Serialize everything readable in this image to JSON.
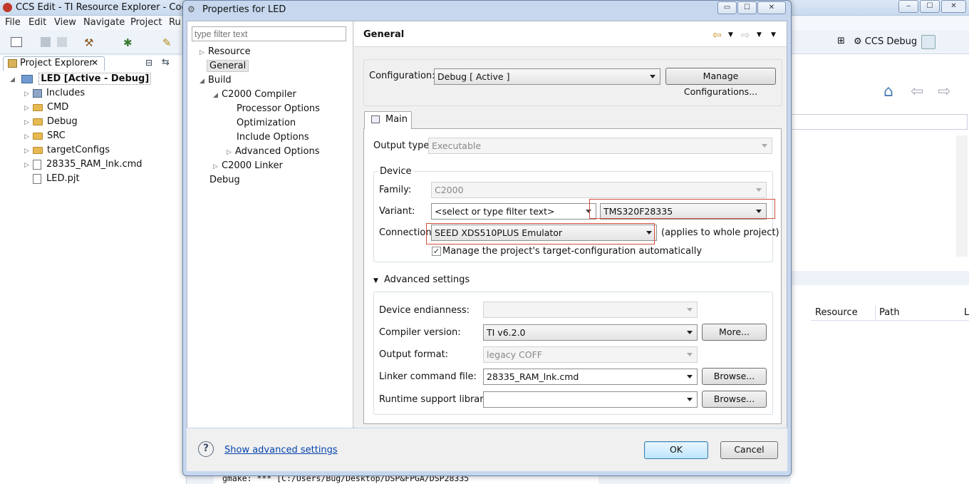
{
  "main_window": {
    "title": "CCS Edit - TI Resource Explorer - Code C",
    "menu": [
      "File",
      "Edit",
      "View",
      "Navigate",
      "Project",
      "Ru"
    ],
    "perspective": "CCS Debug"
  },
  "project_explorer": {
    "tab_label": "Project Explorer",
    "tab_close": "✕",
    "root": "LED  [Active - Debug]",
    "items": [
      "Includes",
      "CMD",
      "Debug",
      "SRC",
      "targetConfigs",
      "28335_RAM_lnk.cmd",
      "LED.pjt"
    ]
  },
  "right_table": {
    "columns": [
      "Resource",
      "Path",
      "L"
    ]
  },
  "console": {
    "line": "gmake: *** [C:/Users/Bug/Desktop/DSP&FPGA/DSP28335"
  },
  "dialog": {
    "title": "Properties for LED",
    "win_buttons": [
      "▭",
      "☐",
      "✕"
    ],
    "filter_placeholder": "type filter text",
    "nav": [
      {
        "label": "Resource",
        "level": 0,
        "arrow": "▷"
      },
      {
        "label": "General",
        "level": 0,
        "selected": true
      },
      {
        "label": "Build",
        "level": 0,
        "arrow": "◢"
      },
      {
        "label": "C2000 Compiler",
        "level": 1,
        "arrow": "◢"
      },
      {
        "label": "Processor Options",
        "level": 2
      },
      {
        "label": "Optimization",
        "level": 2
      },
      {
        "label": "Include Options",
        "level": 2
      },
      {
        "label": "Advanced Options",
        "level": 2,
        "arrow": "▷"
      },
      {
        "label": "C2000 Linker",
        "level": 1,
        "arrow": "▷"
      },
      {
        "label": "Debug",
        "level": 0
      }
    ],
    "page_title": "General",
    "configuration_label": "Configuration:",
    "configuration_value": "Debug  [ Active ]",
    "manage_button": "Manage Configurations...",
    "tab_main": "Main",
    "output_type_label": "Output type:",
    "output_type_value": "Executable",
    "device_group": "Device",
    "family_label": "Family:",
    "family_value": "C2000",
    "variant_label": "Variant:",
    "variant_filter": "<select or type filter text>",
    "variant_value": "TMS320F28335",
    "connection_label": "Connection:",
    "connection_value": "SEED XDS510PLUS Emulator",
    "connection_note": "(applies to whole project)",
    "manage_target_label": "Manage the project's target-configuration automatically",
    "manage_target_checked": "✓",
    "advanced_label": "Advanced settings",
    "endianness_label": "Device endianness:",
    "endianness_value": "",
    "compiler_label": "Compiler version:",
    "compiler_value": "TI v6.2.0",
    "more_button": "More...",
    "output_format_label": "Output format:",
    "output_format_value": "legacy COFF",
    "linker_label": "Linker command file:",
    "linker_value": "28335_RAM_lnk.cmd",
    "browse_button": "Browse...",
    "runtime_label": "Runtime support library:",
    "runtime_value": "",
    "show_advanced": "Show advanced settings",
    "ok": "OK",
    "cancel": "Cancel",
    "help_glyph": "?"
  }
}
